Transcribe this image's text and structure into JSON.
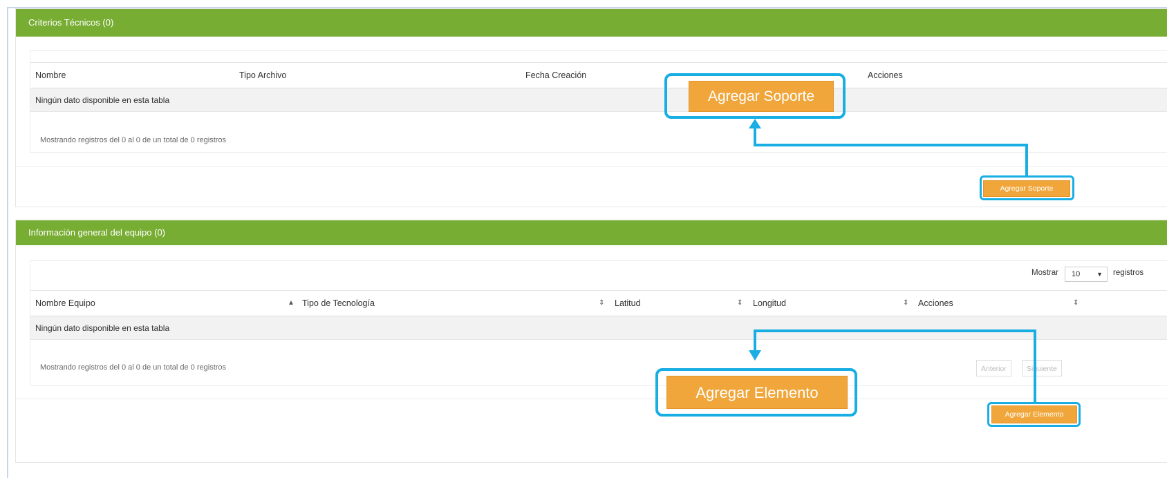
{
  "criterios": {
    "header": "Criterios Técnicos (0)",
    "columns": [
      "Nombre",
      "Tipo Archivo",
      "Fecha Creación",
      "Acciones"
    ],
    "empty_text": "Ningún dato disponible en esta tabla",
    "info_text": "Mostrando registros del 0 al 0 de un total de 0 registros",
    "add_button": "Agregar Soporte",
    "callout_label": "Agregar Soporte"
  },
  "equipo": {
    "header": "Información general del equipo (0)",
    "show_label": "Mostrar",
    "show_value": "10",
    "records_label": "registros",
    "columns": [
      "Nombre Equipo",
      "Tipo de Tecnología",
      "Latitud",
      "Longitud",
      "Acciones"
    ],
    "empty_text": "Ningún dato disponible en esta tabla",
    "info_text": "Mostrando registros del 0 al 0 de un total de 0 registros",
    "prev_button": "Anterior",
    "next_button": "Siguiente",
    "add_button": "Agregar Elemento",
    "callout_label": "Agregar Elemento"
  },
  "colors": {
    "header_green": "#78ad33",
    "button_orange": "#f0a63a",
    "callout_blue": "#19aee3"
  }
}
